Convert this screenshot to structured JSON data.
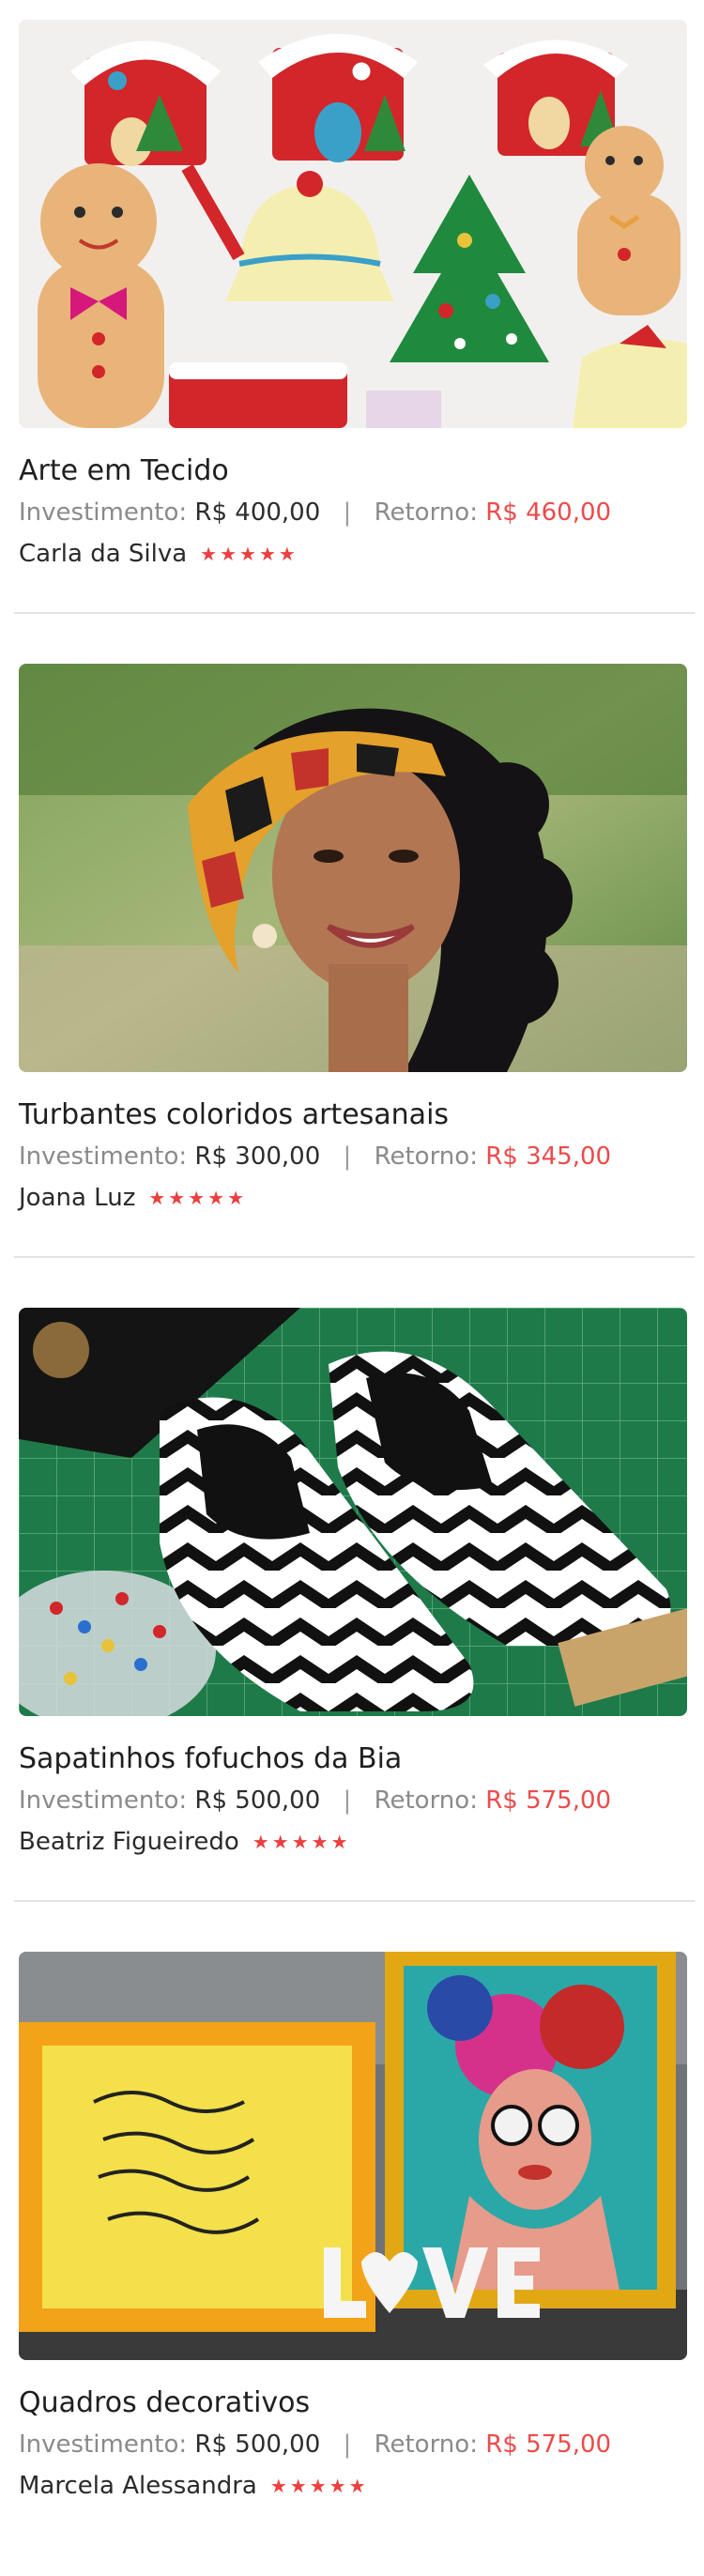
{
  "labels": {
    "investment": "Investimento:",
    "return": "Retorno:",
    "separator": "|"
  },
  "products": [
    {
      "title": "Arte em Tecido",
      "investment": "R$ 400,00",
      "return": "R$ 460,00",
      "author": "Carla da Silva",
      "rating": 5,
      "image_icon": "felt-christmas-ornaments-photo"
    },
    {
      "title": "Turbantes coloridos artesanais",
      "investment": "R$ 300,00",
      "return": "R$ 345,00",
      "author": "Joana Luz",
      "rating": 5,
      "image_icon": "woman-with-turban-photo"
    },
    {
      "title": "Sapatinhos fofuchos da Bia",
      "investment": "R$ 500,00",
      "return": "R$ 575,00",
      "author": "Beatriz Figueiredo",
      "rating": 5,
      "image_icon": "chevron-fabric-slippers-photo"
    },
    {
      "title": "Quadros decorativos",
      "investment": "R$ 500,00",
      "return": "R$ 575,00",
      "author": "Marcela Alessandra",
      "rating": 5,
      "image_icon": "decorative-frames-photo"
    }
  ],
  "colors": {
    "accent": "#ec4b4b",
    "star": "#ec3f3f",
    "divider": "#e3e3e3",
    "muted": "#8a8a8a"
  },
  "star_glyph": "★"
}
